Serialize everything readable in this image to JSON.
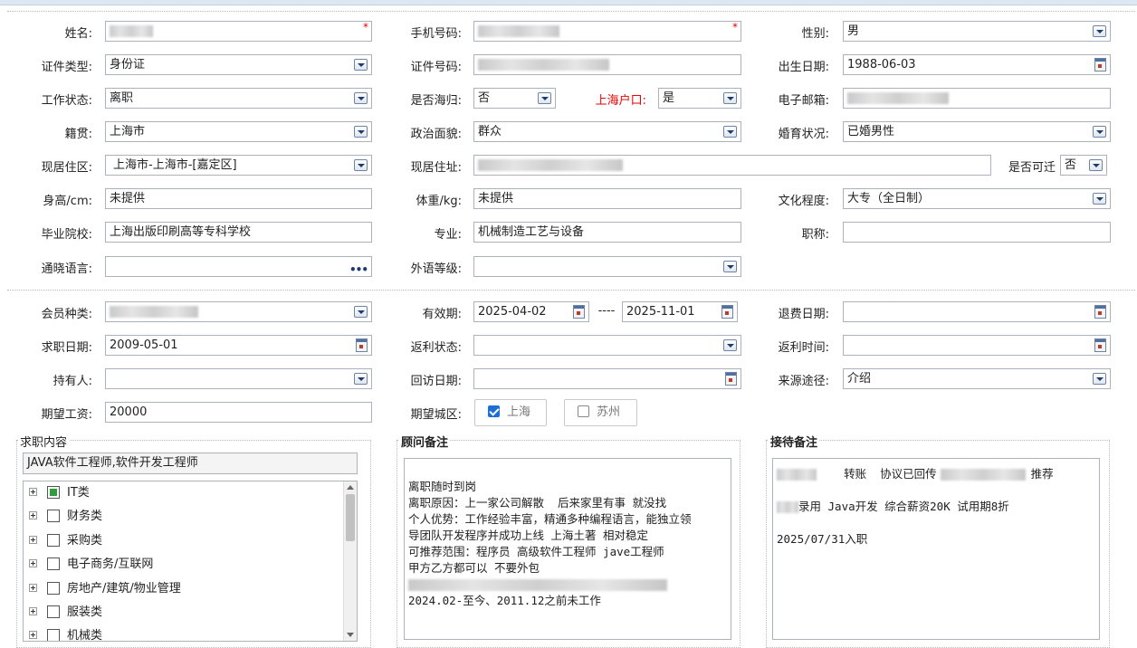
{
  "colors": {
    "accent": "#1b6fd6",
    "required": "#e00000",
    "tree_checked": "#2f9e3a"
  },
  "basic": {
    "name_label": "姓名:",
    "phone_label": "手机号码:",
    "gender_label": "性别:",
    "gender_value": "男",
    "id_type_label": "证件类型:",
    "id_type_value": "身份证",
    "id_number_label": "证件号码:",
    "birth_label": "出生日期:",
    "birth_value": "1988-06-03",
    "work_status_label": "工作状态:",
    "work_status_value": "离职",
    "returnee_label": "是否海归:",
    "returnee_value": "否",
    "hukou_label": "上海户口:",
    "hukou_value": "是",
    "email_label": "电子邮箱:",
    "native_label": "籍贯:",
    "native_value": "上海市",
    "political_label": "政治面貌:",
    "political_value": "群众",
    "marital_label": "婚育状况:",
    "marital_value": "已婚男性",
    "district_label": "现居住区:",
    "district_value": "上海市-上海市-[嘉定区]",
    "address_label": "现居住址:",
    "relocate_label": "是否可迁",
    "relocate_value": "否",
    "height_label": "身高/cm:",
    "height_value": "未提供",
    "weight_label": "体重/kg:",
    "weight_value": "未提供",
    "education_label": "文化程度:",
    "education_value": "大专（全日制）",
    "school_label": "毕业院校:",
    "school_value": "上海出版印刷高等专科学校",
    "major_label": "专业:",
    "major_value": "机械制造工艺与设备",
    "title_label": "职称:",
    "title_value": "",
    "language_label": "通晓语言:",
    "language_value": "",
    "foreign_level_label": "外语等级:",
    "foreign_level_value": "",
    "required_mark": "*",
    "more_icon": "ellipsis-icon"
  },
  "member": {
    "type_label": "会员种类:",
    "valid_label": "有效期:",
    "valid_from": "2025-04-02",
    "valid_sep": "----",
    "valid_to": "2025-11-01",
    "refund_date_label": "退费日期:",
    "refund_date_value": "",
    "job_date_label": "求职日期:",
    "job_date_value": "2009-05-01",
    "rebate_status_label": "返利状态:",
    "rebate_status_value": "",
    "rebate_time_label": "返利时间:",
    "rebate_time_value": "",
    "holder_label": "持有人:",
    "holder_value": "",
    "visit_date_label": "回访日期:",
    "visit_date_value": "",
    "source_label": "来源途径:",
    "source_value": "介绍",
    "salary_label": "期望工资:",
    "salary_value": "20000",
    "city_label": "期望城区:",
    "city_options": [
      {
        "label": "上海",
        "checked": true
      },
      {
        "label": "苏州",
        "checked": false
      }
    ]
  },
  "job_panel": {
    "legend": "求职内容",
    "summary": "JAVA软件工程师,软件开发工程师",
    "tree": [
      {
        "label": "IT类",
        "checked": true
      },
      {
        "label": "财务类",
        "checked": false
      },
      {
        "label": "采购类",
        "checked": false
      },
      {
        "label": "电子商务/互联网",
        "checked": false
      },
      {
        "label": "房地产/建筑/物业管理",
        "checked": false
      },
      {
        "label": "服装类",
        "checked": false
      },
      {
        "label": "机械类",
        "checked": false
      }
    ]
  },
  "advisor_panel": {
    "legend": "顾问备注",
    "lines": [
      "离职随时到岗",
      "离职原因：上一家公司解散  后来家里有事 就没找",
      "个人优势：工作经验丰富，精通多种编程语言，能独立领",
      "导团队开发程序并成功上线 上海土著 相对稳定",
      "可推荐范围：程序员 高级软件工程师 jave工程师",
      "甲方乙方都可以 不要外包",
      "",
      "2024.02-至今、2011.12之前未工作"
    ]
  },
  "reception_panel": {
    "legend": "接待备注",
    "line1_a": "转账  协议已回传",
    "line1_b": "推荐",
    "line2": "录用 Java开发 综合薪资20K 试用期8折",
    "line3": "2025/07/31入职"
  }
}
